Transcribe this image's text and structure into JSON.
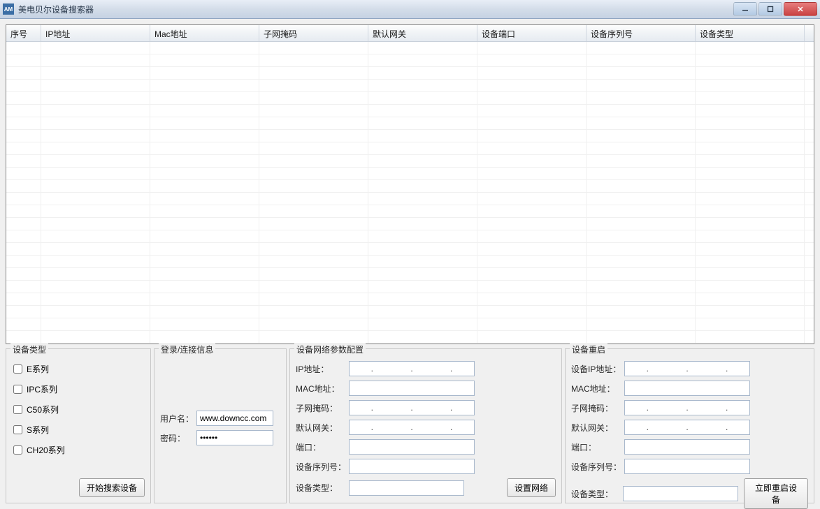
{
  "window": {
    "title": "美电贝尔设备搜索器"
  },
  "table": {
    "columns": [
      "序号",
      "IP地址",
      "Mac地址",
      "子网掩码",
      "默认网关",
      "设备端口",
      "设备序列号",
      "设备类型"
    ]
  },
  "device_type": {
    "legend": "设备类型",
    "items": [
      "E系列",
      "IPC系列",
      "C50系列",
      "S系列",
      "CH20系列"
    ],
    "search_btn": "开始搜索设备"
  },
  "login": {
    "legend": "登录/连接信息",
    "user_label": "用户名：",
    "user_value": "www.downcc.com",
    "pwd_label": "密码：",
    "pwd_value": "••••••"
  },
  "netcfg": {
    "legend": "设备网络参数配置",
    "ip_label": "IP地址：",
    "mac_label": "MAC地址：",
    "mask_label": "子网掩码：",
    "gw_label": "默认网关：",
    "port_label": "端口：",
    "serial_label": "设备序列号：",
    "dtype_label": "设备类型：",
    "btn": "设置网络"
  },
  "reboot": {
    "legend": "设备重启",
    "ip_label": "设备IP地址：",
    "mac_label": "MAC地址：",
    "mask_label": "子网掩码：",
    "gw_label": "默认网关：",
    "port_label": "端口：",
    "serial_label": "设备序列号：",
    "dtype_label": "设备类型：",
    "btn": "立即重启设备"
  }
}
